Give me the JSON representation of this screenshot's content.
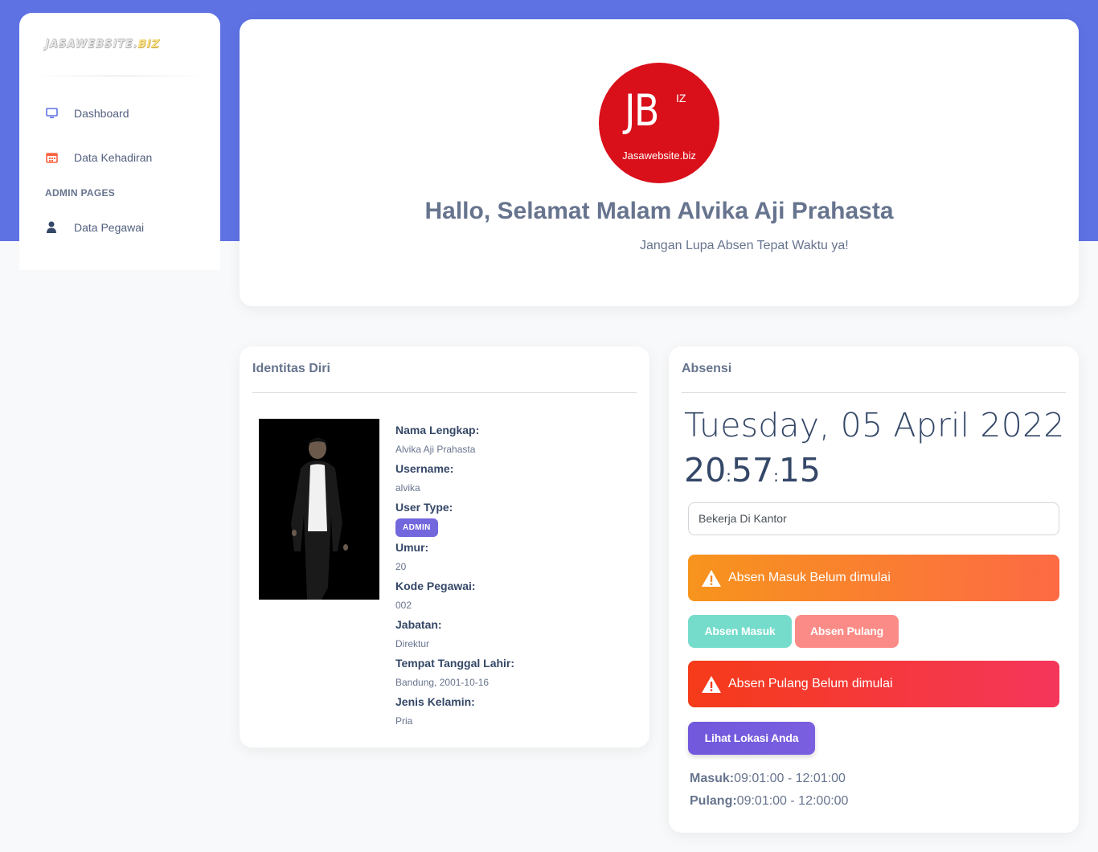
{
  "sidebar": {
    "brand_main": "JASAWEBSITE.",
    "brand_suffix": "BIZ",
    "items": [
      {
        "label": "Dashboard",
        "icon": "monitor-icon",
        "color": "#5e72e4"
      },
      {
        "label": "Data Kehadiran",
        "icon": "calendar-icon",
        "color": "#fb6340"
      }
    ],
    "section_heading": "ADMIN PAGES",
    "admin_items": [
      {
        "label": "Data Pegawai",
        "icon": "user-icon",
        "color": "#344767"
      }
    ]
  },
  "welcome": {
    "logo_initials": "JB",
    "logo_superscript": "IZ",
    "logo_site": "Jasawebsite.biz",
    "greeting": "Hallo, Selamat Malam Alvika Aji Prahasta",
    "subtitle": "Jangan Lupa Absen Tepat Waktu ya!"
  },
  "identity": {
    "title": "Identitas Diri",
    "fields": [
      {
        "label": "Nama Lengkap:",
        "value": "Alvika Aji Prahasta"
      },
      {
        "label": "Username:",
        "value": "alvika"
      },
      {
        "label": "User Type:",
        "badge": "ADMIN"
      },
      {
        "label": "Umur:",
        "value": "20"
      },
      {
        "label": "Kode Pegawai:",
        "value": "002"
      },
      {
        "label": "Jabatan:",
        "value": "Direktur"
      },
      {
        "label": "Tempat Tanggal Lahir:",
        "value": "Bandung, 2001-10-16"
      },
      {
        "label": "Jenis Kelamin:",
        "value": "Pria"
      }
    ]
  },
  "absensi": {
    "title": "Absensi",
    "date": "Tuesday, 05 April 2022",
    "time": {
      "h": "20",
      "m": "57",
      "s": "15",
      "sep": ":"
    },
    "work_mode": "Bekerja Di Kantor",
    "alert_masuk": "Absen Masuk Belum dimulai",
    "btn_masuk": "Absen Masuk",
    "btn_pulang": "Absen Pulang",
    "alert_pulang": "Absen Pulang Belum dimulai",
    "btn_lokasi": "Lihat Lokasi Anda",
    "masuk_label": "Masuk:",
    "masuk_value": "09:01:00 - 12:01:00",
    "pulang_label": "Pulang:",
    "pulang_value": "09:01:00 - 12:00:00"
  },
  "colors": {
    "primary": "#5e72e4",
    "warning_gradient": [
      "#f7941d",
      "#fd6a44"
    ],
    "danger_gradient": [
      "#f53b19",
      "#f5365c"
    ],
    "success": "#75dccb",
    "danger_soft": "#fb8b86",
    "purple": "#7158dc"
  }
}
